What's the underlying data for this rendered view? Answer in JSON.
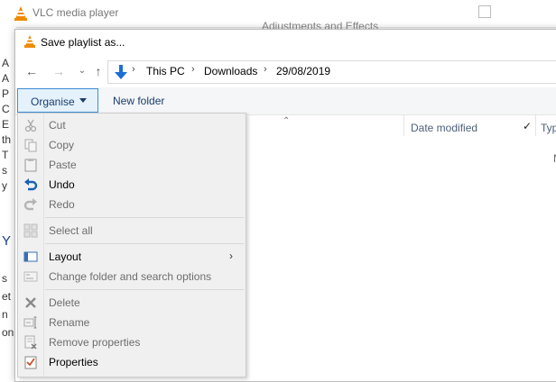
{
  "vlc_window": {
    "title": "VLC media player",
    "background_title": "Adjustments and Effects",
    "left_strip_text": [
      "A",
      "A",
      "P",
      "C",
      "E",
      "th",
      "T",
      "s",
      "y",
      "Y",
      "s",
      "et",
      "n",
      "on"
    ]
  },
  "dialog": {
    "title": "Save playlist as...",
    "breadcrumb": [
      "This PC",
      "Downloads",
      "29/08/2019"
    ],
    "toolbar": {
      "organise_label": "Organise",
      "new_folder_label": "New folder"
    },
    "columns": {
      "date_modified": "Date modified",
      "type": "Typ"
    },
    "empty_text": "N"
  },
  "menu": {
    "items": [
      {
        "label": "Cut",
        "enabled": false,
        "icon": "scissors-icon"
      },
      {
        "label": "Copy",
        "enabled": false,
        "icon": "copy-icon"
      },
      {
        "label": "Paste",
        "enabled": false,
        "icon": "paste-icon"
      },
      {
        "label": "Undo",
        "enabled": true,
        "icon": "undo-icon"
      },
      {
        "label": "Redo",
        "enabled": false,
        "icon": "redo-icon"
      },
      {
        "label": "Select all",
        "enabled": false,
        "icon": "select-all-icon"
      },
      {
        "label": "Layout",
        "enabled": true,
        "icon": "layout-icon",
        "submenu": true
      },
      {
        "label": "Change folder and search options",
        "enabled": false,
        "icon": "folder-options-icon"
      },
      {
        "label": "Delete",
        "enabled": false,
        "icon": "delete-icon"
      },
      {
        "label": "Rename",
        "enabled": false,
        "icon": "rename-icon"
      },
      {
        "label": "Remove properties",
        "enabled": false,
        "icon": "remove-properties-icon"
      },
      {
        "label": "Properties",
        "enabled": true,
        "icon": "properties-icon"
      }
    ]
  },
  "colors": {
    "accent_blue": "#3c8fd9",
    "menu_bg": "#f0f0f0",
    "vlc_orange": "#f08a00",
    "undo_blue": "#1a5fb4"
  }
}
